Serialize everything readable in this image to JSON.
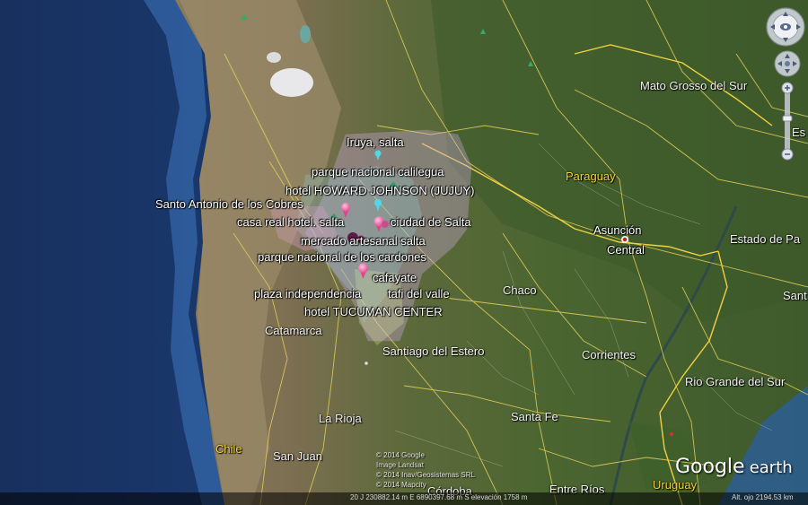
{
  "map": {
    "placemarks": [
      {
        "label": "Iruya, salta"
      },
      {
        "label": "parque nacional calilegua"
      },
      {
        "label": "hotel HOWARD JOHNSON (JUJUY)"
      },
      {
        "label": "Santo Antonio de los Cobres"
      },
      {
        "label": "casa real hotel. salta"
      },
      {
        "label": "ciudad de Salta"
      },
      {
        "label": "mercado artesanal salta"
      },
      {
        "label": "parque nacional de los cardones"
      },
      {
        "label": "cafayate"
      },
      {
        "label": "plaza independencia"
      },
      {
        "label": "tafi del valle"
      },
      {
        "label": "hotel TUCUMAN CENTER"
      }
    ],
    "regions": [
      {
        "label": "Mato Grosso del Sur"
      },
      {
        "label": "Chaco"
      },
      {
        "label": "Catamarca"
      },
      {
        "label": "Santiago del Estero"
      },
      {
        "label": "Corrientes"
      },
      {
        "label": "Rio Grande del Sur"
      },
      {
        "label": "La Rioja"
      },
      {
        "label": "Santa Fe"
      },
      {
        "label": "San Juan"
      },
      {
        "label": "Córdoba"
      },
      {
        "label": "Entre Ríos"
      },
      {
        "label": "Estado de Pa"
      },
      {
        "label": "Sant"
      },
      {
        "label": "Es"
      }
    ],
    "countries": [
      {
        "label": "Paraguay"
      },
      {
        "label": "Chile"
      },
      {
        "label": "Uruguay"
      }
    ],
    "capital": {
      "label": "Asunción",
      "label2": "Central"
    },
    "attribution": [
      "© 2014 Google",
      "Image Landsat",
      "© 2014 Inav/Geosistemas SRL",
      "© 2014 Mapcity"
    ],
    "logo": {
      "google": "Google",
      "earth": "earth"
    }
  },
  "status_bar": {
    "coords": "20 J 230882.14 m E 6890397.68 m S  elevación  1758 m",
    "eye_alt": "Alt. ojo  2194.53 km"
  },
  "colors": {
    "ocean": "#1b3a6e",
    "land": "#4f6b34",
    "arid": "#8a7a5c",
    "road": "#e8d35a",
    "pin_pink": "#f06aa8",
    "pin_cyan": "#4fd8e8"
  }
}
